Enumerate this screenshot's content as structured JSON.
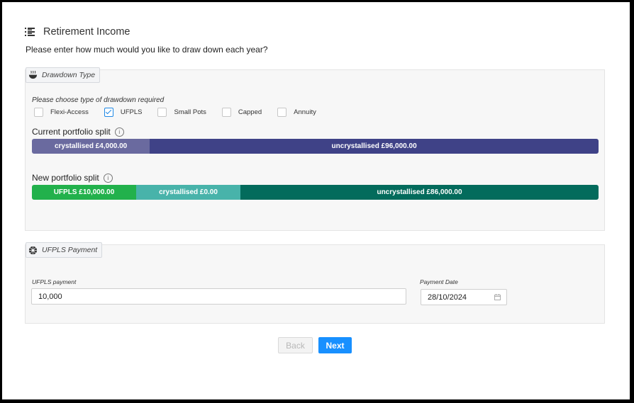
{
  "header": {
    "title": "Retirement Income",
    "icon": "list-icon"
  },
  "question": "Please enter how much would you like to draw down each year?",
  "drawdown": {
    "legend": "Drawdown Type",
    "icon": "bowl-icon",
    "instruction": "Please choose type of drawdown required",
    "options": [
      {
        "label": "Flexi-Access",
        "checked": false
      },
      {
        "label": "UFPLS",
        "checked": true
      },
      {
        "label": "Small Pots",
        "checked": false
      },
      {
        "label": "Capped",
        "checked": false
      },
      {
        "label": "Annuity",
        "checked": false
      }
    ],
    "current_split": {
      "label": "Current portfolio split",
      "segments": [
        {
          "label": "crystallised £4,000.00",
          "share": 0.208,
          "color": "#6a6a9f"
        },
        {
          "label": "uncrystallised £96,000.00",
          "share": 0.792,
          "color": "#3f4287"
        }
      ]
    },
    "new_split": {
      "label": "New portfolio split",
      "segments": [
        {
          "label": "UFPLS £10,000.00",
          "share": 0.184,
          "color": "#22b14c"
        },
        {
          "label": "crystallised £0.00",
          "share": 0.184,
          "color": "#48b3aa"
        },
        {
          "label": "uncrystallised £86,000.00",
          "share": 0.632,
          "color": "#036b5c"
        }
      ]
    }
  },
  "ufpls": {
    "legend": "UFPLS Payment",
    "icon": "settings-icon",
    "payment_label": "UFPLS payment",
    "payment_value": "10,000",
    "date_label": "Payment Date",
    "date_value": "28/10/2024"
  },
  "buttons": {
    "back": "Back",
    "next": "Next"
  },
  "colors": {
    "accent": "#1890ff",
    "check": "#1e88e5"
  }
}
